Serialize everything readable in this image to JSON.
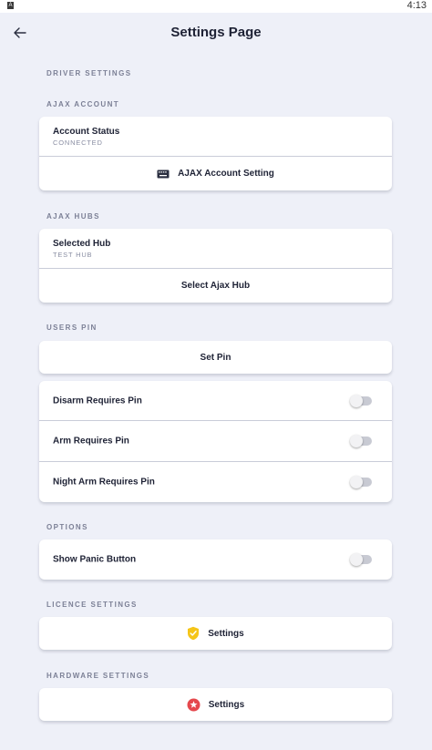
{
  "status_bar": {
    "time": "4:13",
    "app_icon": "A"
  },
  "header": {
    "title": "Settings Page",
    "back_icon": "arrow-left-icon"
  },
  "sections": {
    "driver": {
      "label": "DRIVER SETTINGS"
    },
    "ajax_account": {
      "label": "AJAX ACCOUNT",
      "status_title": "Account Status",
      "status_value": "CONNECTED",
      "setting_button": "AJAX Account Setting",
      "setting_icon": "keyboard-icon"
    },
    "ajax_hubs": {
      "label": "AJAX HUBS",
      "hub_title": "Selected Hub",
      "hub_value": "TEST HUB",
      "select_button": "Select Ajax Hub"
    },
    "users_pin": {
      "label": "USERS PIN",
      "set_pin_button": "Set Pin",
      "toggles": [
        {
          "label": "Disarm Requires Pin",
          "on": false
        },
        {
          "label": "Arm Requires Pin",
          "on": false
        },
        {
          "label": "Night Arm Requires Pin",
          "on": false
        }
      ]
    },
    "options": {
      "label": "OPTIONS",
      "panic_label": "Show Panic Button",
      "panic_on": false
    },
    "licence": {
      "label": "LICENCE SETTINGS",
      "button": "Settings",
      "icon": "shield-check-icon",
      "icon_color": "#f5c518"
    },
    "hardware": {
      "label": "HARDWARE SETTINGS",
      "button": "Settings",
      "icon": "star-badge-icon",
      "icon_color": "#e5484d"
    }
  }
}
